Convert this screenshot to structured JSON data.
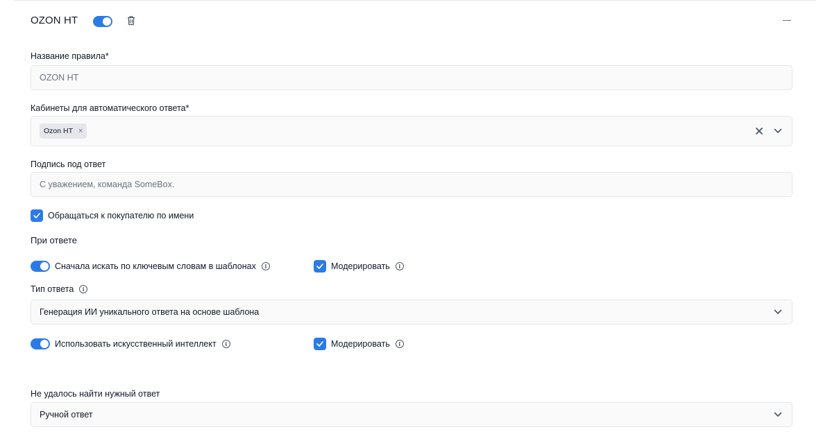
{
  "rule": {
    "title": "OZON HT"
  },
  "fields": {
    "name_label": "Название правила*",
    "name_value": "OZON HT",
    "cabinets_label": "Кабинеты для автоматического ответа*",
    "cabinets_chips": [
      "Ozon HT"
    ],
    "signature_label": "Подпись под ответ",
    "signature_placeholder": "С уважением, команда SomeBox.",
    "address_by_name_label": "Обращаться к покупателю по имени"
  },
  "on_answer": {
    "heading": "При ответе",
    "keyword_search_label": "Сначала искать по ключевым словам в шаблонах",
    "moderate_label_1": "Модерировать",
    "answer_type_label": "Тип ответа",
    "answer_type_value": "Генерация ИИ уникального ответа на основе шаблона",
    "use_ai_label": "Использовать искусственный интеллект",
    "moderate_label_2": "Модерировать"
  },
  "fallback": {
    "label": "Не удалось найти нужный ответ",
    "value": "Ручной ответ"
  },
  "icons": {
    "info": "i"
  },
  "colors": {
    "accent": "#2b7be6",
    "field_bg": "#fafafa",
    "border": "#e3e6ea"
  }
}
